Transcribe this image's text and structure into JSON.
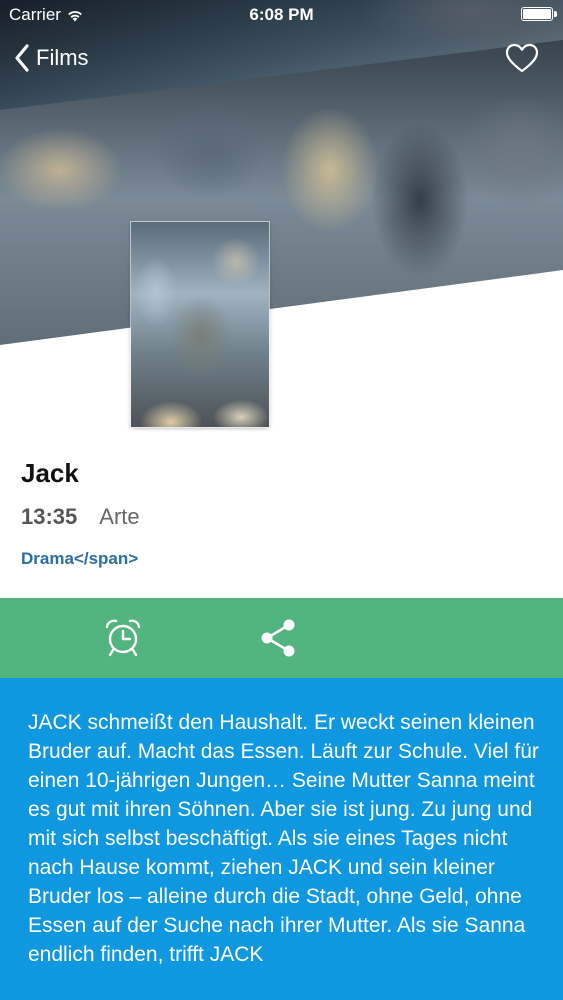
{
  "status_bar": {
    "carrier": "Carrier",
    "time": "6:08 PM"
  },
  "nav": {
    "back_label": "Films",
    "back_icon": "chevron-left-icon",
    "favorite_icon": "heart-icon"
  },
  "film": {
    "title": "Jack",
    "time": "13:35",
    "channel": "Arte",
    "genre": "Drama</span>"
  },
  "actions": {
    "items": [
      {
        "icon": "alarm-clock-icon"
      },
      {
        "icon": "share-icon"
      }
    ],
    "bar_color": "#52b47f"
  },
  "description": {
    "text": "JACK schmeißt den Haushalt. Er weckt seinen kleinen Bruder auf. Macht das Essen. Läuft zur Schule. Viel für einen 10-jährigen Jungen… Seine Mutter Sanna meint es gut mit ihren Söhnen. Aber sie ist jung. Zu jung und mit sich selbst beschäftigt. Als sie eines Tages nicht nach Hause kommt, ziehen JACK und sein kleiner Bruder los – alleine durch die Stadt, ohne Geld, ohne Essen auf der Suche nach ihrer Mutter. Als sie Sanna endlich finden, trifft JACK",
    "background_color": "#0f97e0"
  }
}
